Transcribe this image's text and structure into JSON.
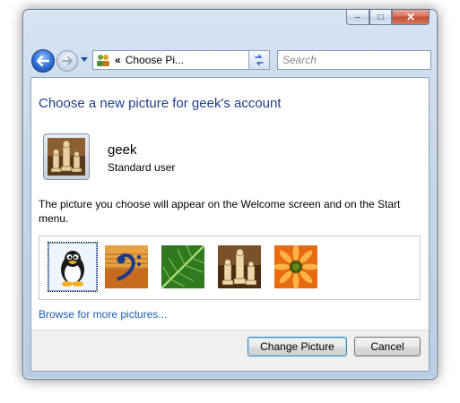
{
  "window": {
    "minimize_label": "–",
    "maximize_label": "□",
    "close_label": "✕"
  },
  "toolbar": {
    "address_separator": "«",
    "address_text": "Choose Pi...",
    "search_placeholder": "Search"
  },
  "main": {
    "title": "Choose a new picture for geek's account",
    "user_name": "geek",
    "user_role": "Standard user",
    "description": "The picture you choose will appear on the Welcome screen and on the Start menu.",
    "pictures": [
      {
        "name": "penguin",
        "selected": true
      },
      {
        "name": "guitar-clef",
        "selected": false
      },
      {
        "name": "green-leaf",
        "selected": false
      },
      {
        "name": "chess-pieces",
        "selected": false
      },
      {
        "name": "orange-flower",
        "selected": false
      }
    ],
    "browse_link": "Browse for more pictures..."
  },
  "footer": {
    "change_label": "Change Picture",
    "cancel_label": "Cancel"
  },
  "colors": {
    "title": "#1e3e8c",
    "link": "#1b5fb5",
    "accent": "#2c6ed6"
  }
}
